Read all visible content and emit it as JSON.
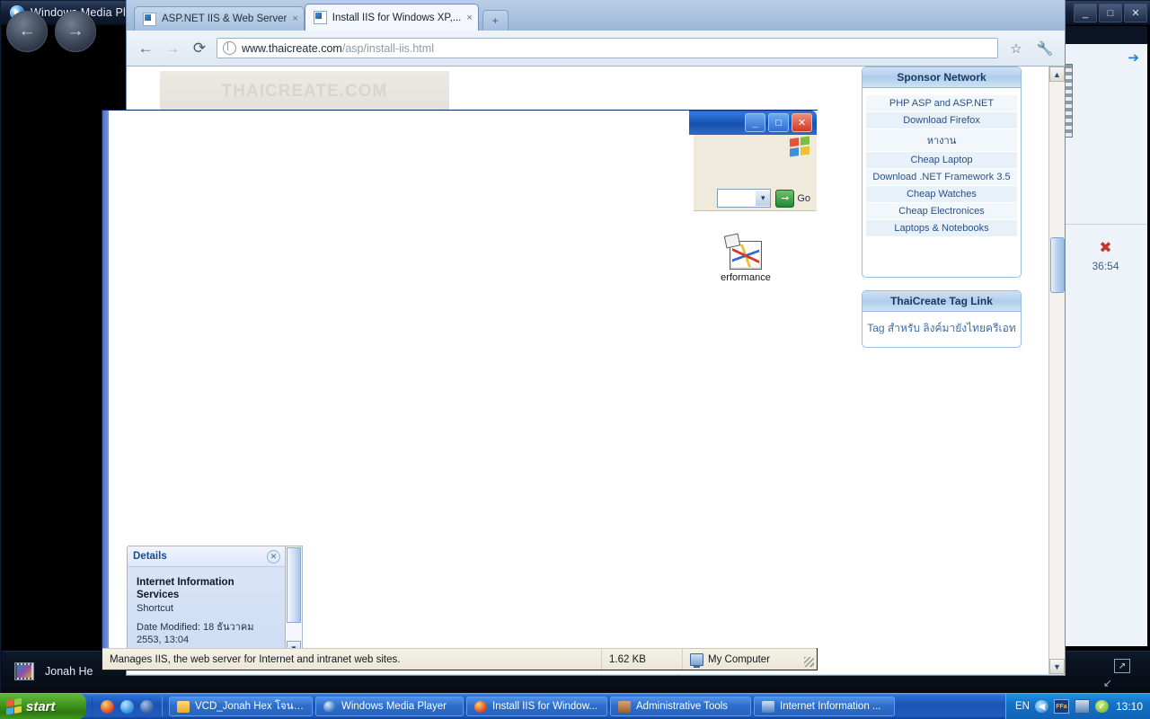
{
  "media_player": {
    "title": "Windows Media Player",
    "nav_back_icon": "back-arrow-icon",
    "nav_forward_icon": "forward-arrow-icon",
    "minimize_label": "_",
    "maximize_label": "□",
    "close_label": "✕",
    "track_label": "Jonah He",
    "playlist": {
      "arrow_icon": "blue-right-arrow-icon",
      "film_icon": "film-strip-icon",
      "remove_icon": "red-x-icon",
      "duration": "36:54"
    }
  },
  "browser": {
    "tabs": [
      {
        "title": "ASP.NET IIS & Web Server",
        "close": "×",
        "active": false
      },
      {
        "title": "Install IIS for Windows XP,...",
        "close": "×",
        "active": true
      }
    ],
    "new_tab_label": "+",
    "toolbar": {
      "back_icon": "←",
      "forward_icon": "→",
      "reload_icon": "⟳",
      "bookmark_icon": "☆",
      "menu_icon": "wrench-icon"
    },
    "address": {
      "domain": "www.thaicreate.com",
      "path": "/asp/install-iis.html"
    },
    "page": {
      "banner_text": "THAICREATE.COM",
      "sponsor_box": {
        "heading": "Sponsor Network",
        "links": [
          "PHP ASP and ASP.NET",
          "Download Firefox",
          "หางาน",
          "Cheap Laptop",
          "Download .NET Framework 3.5",
          "Cheap Watches",
          "Cheap Electronices",
          "Laptops & Notebooks"
        ]
      },
      "tag_box": {
        "heading": "ThaiCreate Tag Link",
        "text": "Tag สำหรับ ลิงค์มายังไทยครีเอท"
      }
    },
    "scrollbar": {
      "up": "▲",
      "down": "▼"
    }
  },
  "explorer": {
    "window_buttons": {
      "minimize": "_",
      "maximize": "□",
      "close": "✕"
    },
    "address_go_label": "Go",
    "address_dropdown_icon": "▾",
    "icons": [
      {
        "label": "erformance",
        "icon_name": "performance-monitor-icon"
      }
    ],
    "details_panel": {
      "title": "Details",
      "close": "✕",
      "item_name": "Internet Information Services",
      "item_type": "Shortcut",
      "date_modified": "Date Modified: 18 ธันวาคม 2553, 13:04"
    },
    "status_bar": {
      "hint": "Manages IIS, the web server for Internet and intranet web sites.",
      "size": "1.62 KB",
      "location": "My Computer"
    },
    "pane_scroll": {
      "down": "▼"
    }
  },
  "taskbar": {
    "start_label": "start",
    "quick_launch": [
      {
        "name": "browser-opera-icon",
        "color": "#d8422a"
      },
      {
        "name": "internet-explorer-icon",
        "color": "#2f8ee0"
      },
      {
        "name": "media-icon",
        "color": "#3a5f9c"
      }
    ],
    "tasks": [
      {
        "label": "VCD_Jonah Hex โจนา...",
        "icon": "folder-icon",
        "color": "#e8b74a"
      },
      {
        "label": "Windows Media Player",
        "icon": "media-player-icon",
        "color": "#2f6fbd"
      },
      {
        "label": "Install IIS for Window...",
        "icon": "browser-icon",
        "color": "#d8422a"
      },
      {
        "label": "Administrative Tools",
        "icon": "admin-tools-icon",
        "color": "#b06a3a"
      },
      {
        "label": "Internet Information ...",
        "icon": "iis-icon",
        "color": "#4a7fbf"
      }
    ],
    "tray": {
      "language": "EN",
      "icons": [
        {
          "name": "previous-icon",
          "glyph": "◀"
        },
        {
          "name": "firefox-alert-icon",
          "glyph": "FFa"
        },
        {
          "name": "network-icon",
          "glyph": "ᴱ"
        },
        {
          "name": "security-shield-icon",
          "glyph": "✓"
        }
      ],
      "clock": "13:10"
    }
  },
  "colors": {
    "taskbar_blue": "#1c53b4",
    "start_green": "#41941f",
    "xp_title_blue": "#1750ad",
    "accent_link": "#2a5083"
  }
}
